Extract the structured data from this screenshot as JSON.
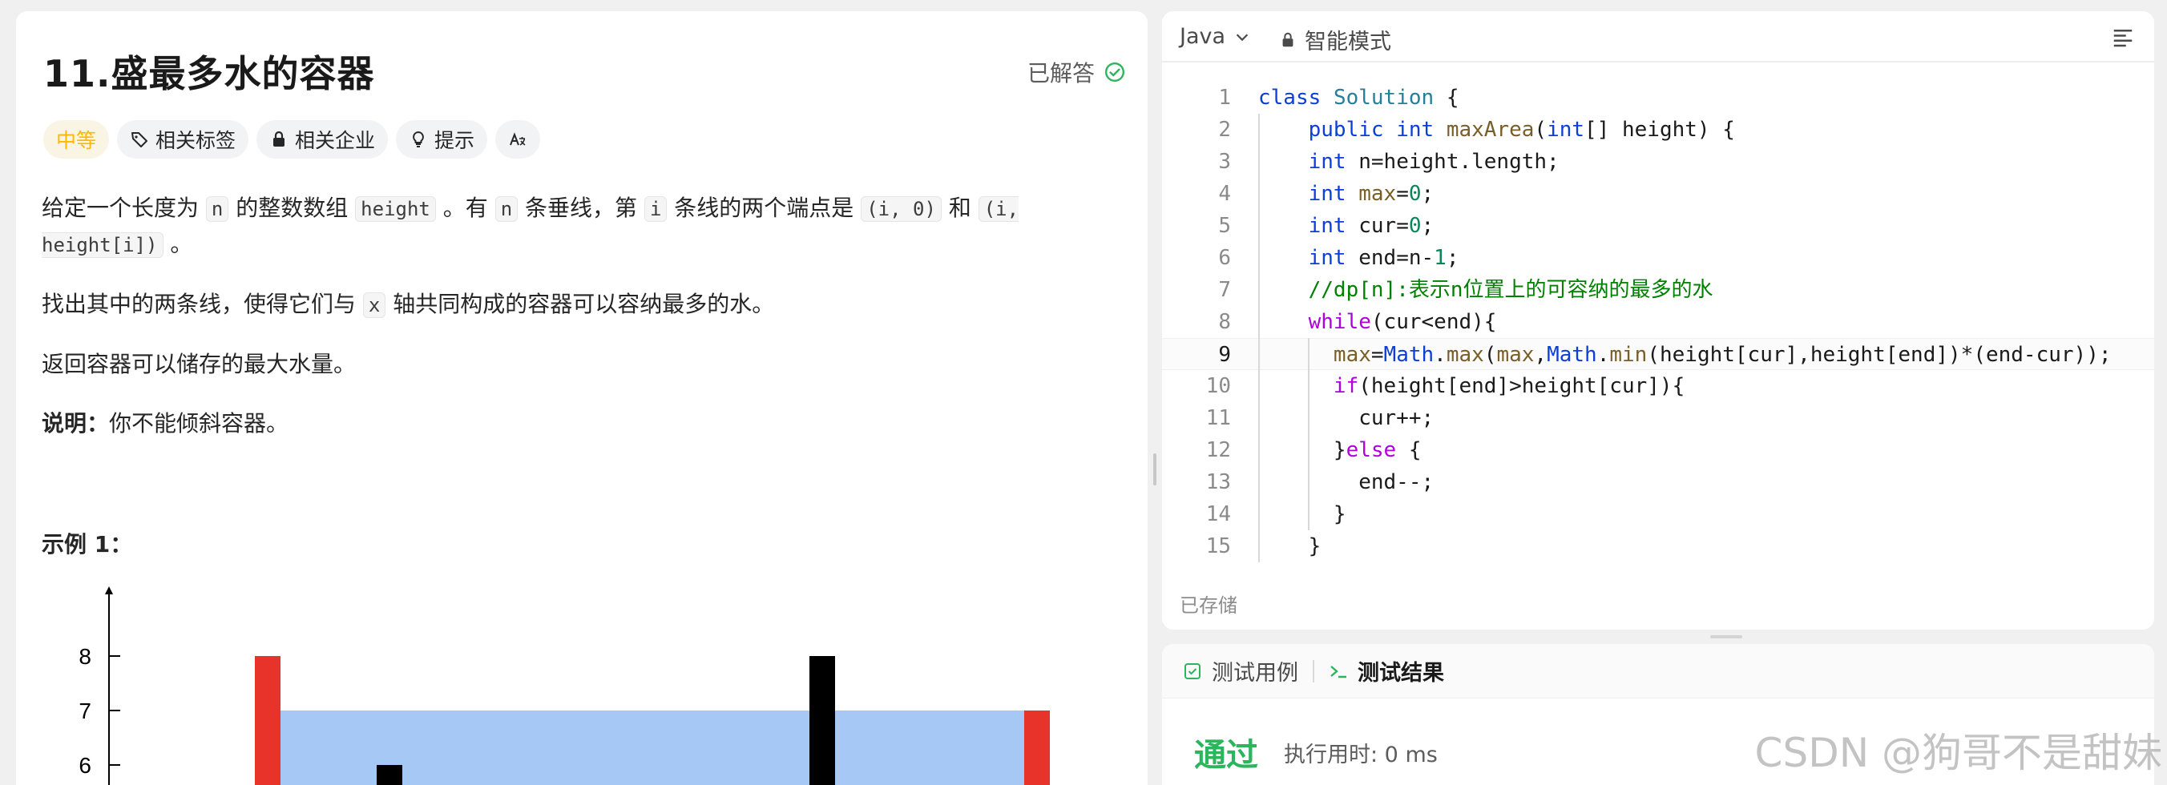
{
  "problem": {
    "title": "11.盛最多水的容器",
    "status": "已解答",
    "tags": {
      "difficulty": "中等",
      "related_tags": "相关标签",
      "related_companies": "相关企业",
      "hint": "提示",
      "translate": "Aあ"
    },
    "description": {
      "p1_a": "给定一个长度为 ",
      "p1_code_n": "n",
      "p1_b": " 的整数数组 ",
      "p1_code_height": "height",
      "p1_c": " 。有 ",
      "p1_code_n2": "n",
      "p1_d": " 条垂线，第 ",
      "p1_code_i": "i",
      "p1_e": " 条线的两个端点是 ",
      "p1_code_pt1": "(i, 0)",
      "p1_f": " 和 ",
      "p1_code_pt2": "(i, height[i])",
      "p1_g": " 。",
      "p2_a": "找出其中的两条线，使得它们与 ",
      "p2_code_x": "x",
      "p2_b": " 轴共同构成的容器可以容纳最多的水。",
      "p3": "返回容器可以储存的最大水量。",
      "p4_bold": "说明：",
      "p4_rest": "你不能倾斜容器。"
    },
    "example_title": "示例 1："
  },
  "chart_data": {
    "type": "bar",
    "yticks": [
      6,
      7,
      8
    ],
    "bars": [
      {
        "value": 8,
        "color": "#e8332a"
      },
      {
        "value": 6,
        "color": "#000000"
      },
      {
        "value": 8,
        "color": "#000000"
      },
      {
        "value": 7,
        "color": "#e8332a"
      }
    ],
    "water_level": 7,
    "water_color": "#a6c8f5"
  },
  "editor": {
    "language": "Java",
    "mode": "智能模式",
    "saved": "已存储",
    "lines": [
      "class Solution {",
      "    public int maxArea(int[] height) {",
      "    int n=height.length;",
      "    int max=0;",
      "    int cur=0;",
      "    int end=n-1;",
      "    //dp[n]:表示n位置上的可容纳的最多的水",
      "    while(cur<end){",
      "      max=Math.max(max,Math.min(height[cur],height[end])*(end-cur));",
      "      if(height[end]>height[cur]){",
      "        cur++;",
      "      }else {",
      "        end--;",
      "      }",
      "    }"
    ]
  },
  "result": {
    "tab_testcase": "测试用例",
    "tab_result": "测试结果",
    "status": "通过",
    "runtime": "执行用时: 0 ms"
  },
  "watermark": "CSDN @狗哥不是甜妹"
}
